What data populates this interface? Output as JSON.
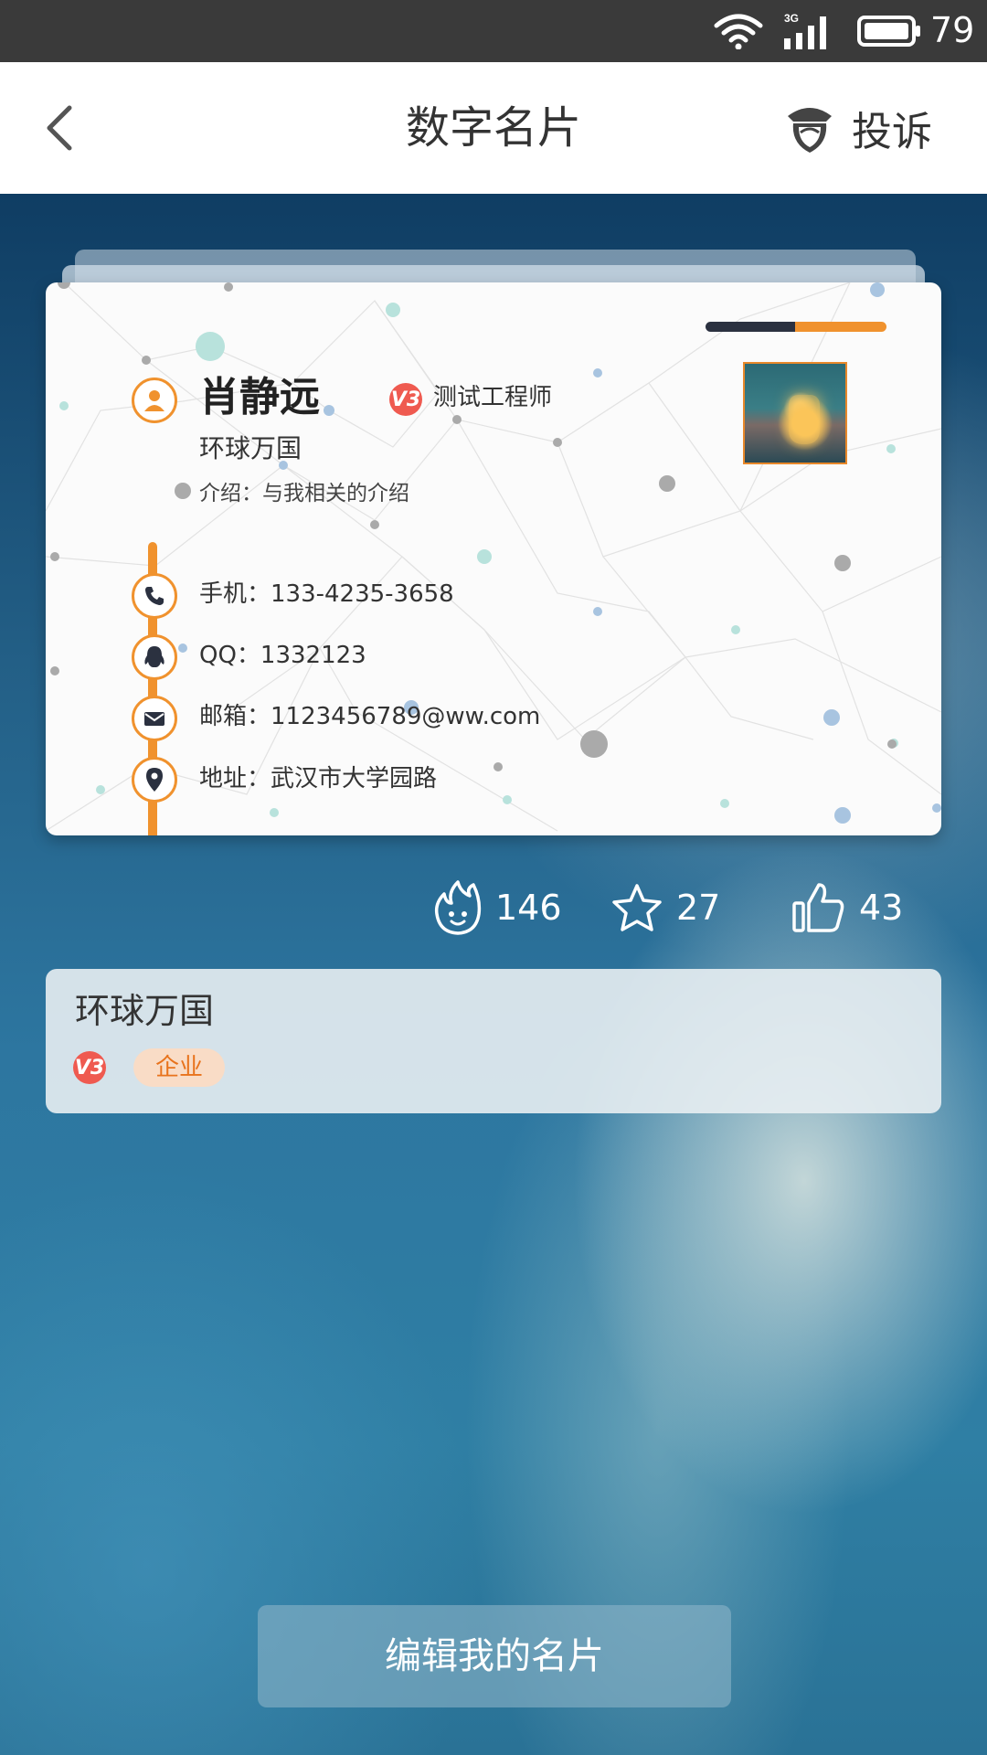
{
  "status_bar": {
    "network": "3G",
    "battery": "79"
  },
  "nav": {
    "title": "数字名片",
    "report_label": "投诉"
  },
  "card": {
    "name": "肖静远",
    "badge": "V3",
    "job_title": "测试工程师",
    "company": "环球万国",
    "intro": "介绍：与我相关的介绍",
    "phone": "手机：133-4235-3658",
    "qq": "QQ：1332123",
    "email": "邮箱：1123456789@ww.com",
    "address": "地址：武汉市大学园路"
  },
  "stats": {
    "hot": "146",
    "favorites": "27",
    "likes": "43"
  },
  "company_panel": {
    "name": "环球万国",
    "badge": "V3",
    "tag": "企业"
  },
  "edit_button": {
    "label": "编辑我的名片"
  },
  "colors": {
    "accent": "#f0922e",
    "badge_red": "#ef5a50",
    "dark": "#2b3140"
  }
}
